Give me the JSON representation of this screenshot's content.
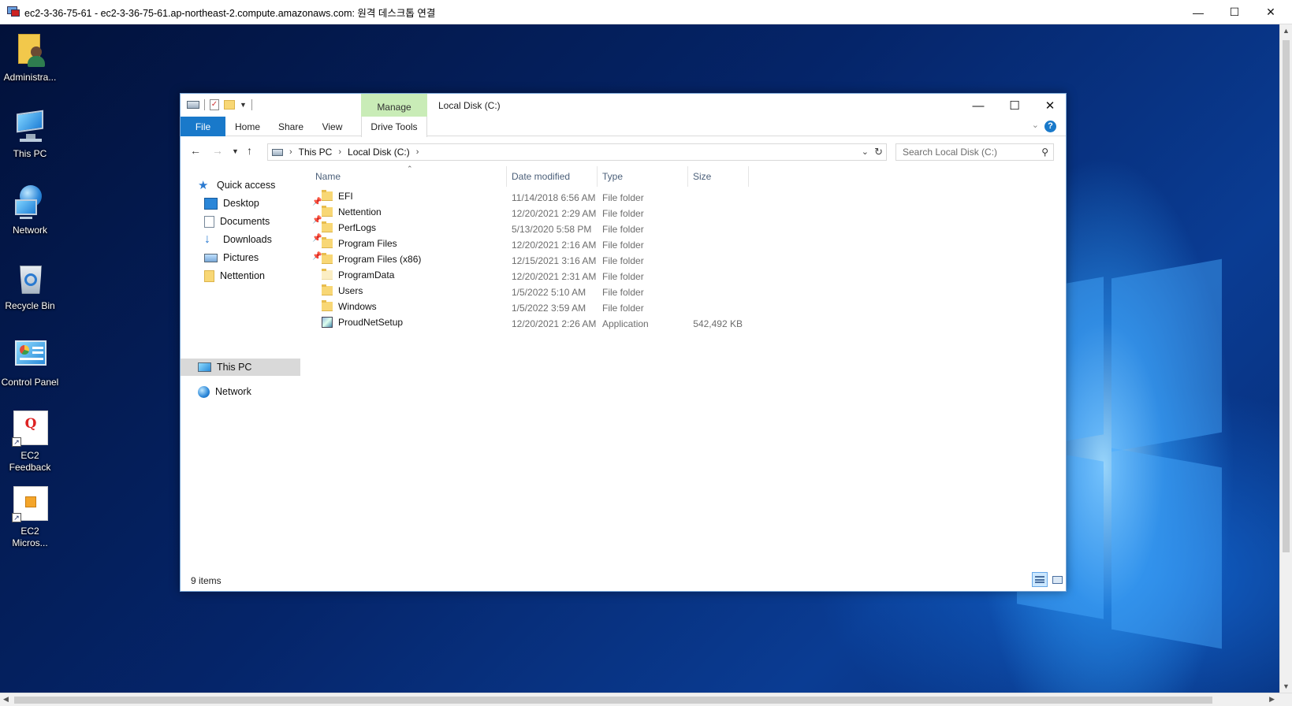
{
  "rdp": {
    "title": "ec2-3-36-75-61 - ec2-3-36-75-61.ap-northeast-2.compute.amazonaws.com: 원격 데스크톱 연결"
  },
  "desktop": {
    "icons": [
      {
        "label": "Administra...",
        "icon": "user-folder-icon"
      },
      {
        "label": "This PC",
        "icon": "computer-icon"
      },
      {
        "label": "Network",
        "icon": "network-globe-icon"
      },
      {
        "label": "Recycle Bin",
        "icon": "recycle-bin-icon"
      },
      {
        "label": "Control Panel",
        "icon": "control-panel-icon"
      },
      {
        "label": "EC2\nFeedback",
        "icon": "feedback-shortcut-icon"
      },
      {
        "label": "EC2\nMicros...",
        "icon": "box-shortcut-icon"
      }
    ]
  },
  "explorer": {
    "manage_tab": "Manage",
    "title": "Local Disk (C:)",
    "ribbon_tabs": {
      "file": "File",
      "home": "Home",
      "share": "Share",
      "view": "View",
      "drive_tools": "Drive Tools"
    },
    "help_label": "?",
    "address": {
      "crumbs": [
        "This PC",
        "Local Disk (C:)"
      ]
    },
    "search_placeholder": "Search Local Disk (C:)",
    "nav": {
      "quick_access": "Quick access",
      "items": [
        "Desktop",
        "Documents",
        "Downloads",
        "Pictures",
        "Nettention"
      ],
      "this_pc": "This PC",
      "network": "Network"
    },
    "columns": {
      "name": "Name",
      "date": "Date modified",
      "type": "Type",
      "size": "Size"
    },
    "files": [
      {
        "name": "EFI",
        "date": "11/14/2018 6:56 AM",
        "type": "File folder",
        "size": ""
      },
      {
        "name": "Nettention",
        "date": "12/20/2021 2:29 AM",
        "type": "File folder",
        "size": ""
      },
      {
        "name": "PerfLogs",
        "date": "5/13/2020 5:58 PM",
        "type": "File folder",
        "size": ""
      },
      {
        "name": "Program Files",
        "date": "12/20/2021 2:16 AM",
        "type": "File folder",
        "size": ""
      },
      {
        "name": "Program Files (x86)",
        "date": "12/15/2021 3:16 AM",
        "type": "File folder",
        "size": ""
      },
      {
        "name": "ProgramData",
        "date": "12/20/2021 2:31 AM",
        "type": "File folder",
        "size": ""
      },
      {
        "name": "Users",
        "date": "1/5/2022 5:10 AM",
        "type": "File folder",
        "size": ""
      },
      {
        "name": "Windows",
        "date": "1/5/2022 3:59 AM",
        "type": "File folder",
        "size": ""
      },
      {
        "name": "ProudNetSetup",
        "date": "12/20/2021 2:26 AM",
        "type": "Application",
        "size": "542,492 KB"
      }
    ],
    "status": "9 items"
  }
}
